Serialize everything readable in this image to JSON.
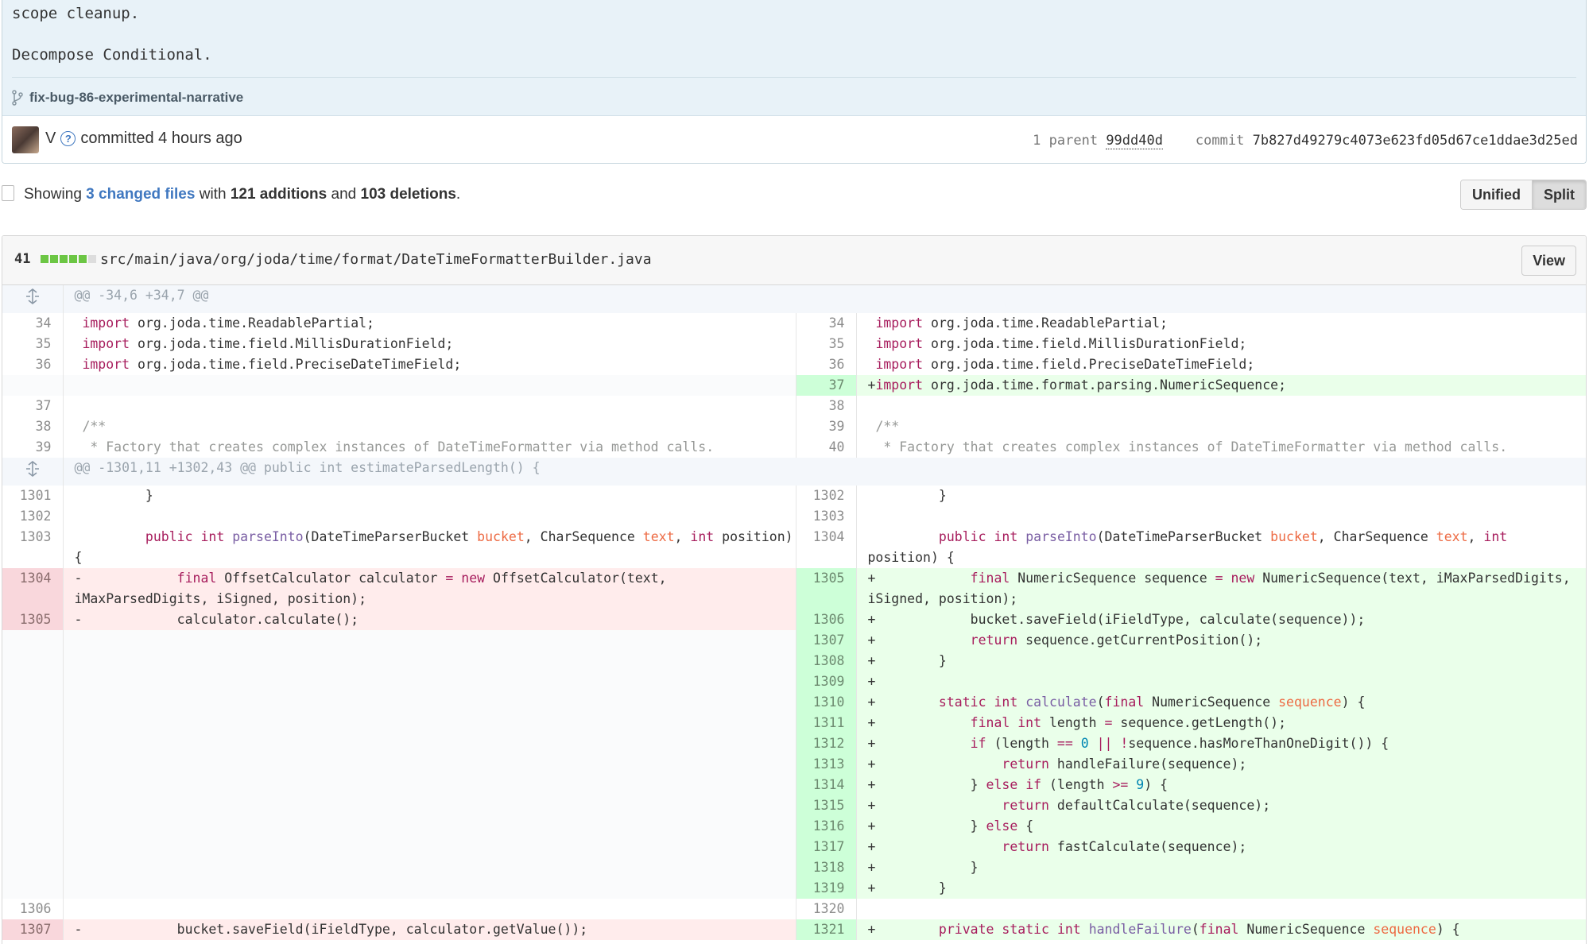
{
  "commit": {
    "message_lines": [
      "scope cleanup.",
      "Decompose Conditional."
    ],
    "branch": "fix-bug-86-experimental-narrative",
    "author": "V",
    "committed_text": "committed 4 hours ago",
    "parent_label": "1 parent",
    "parent_sha": "99dd40d",
    "commit_label": "commit",
    "commit_sha": "7b827d49279c4073e623fd05d67ce1ddae3d25ed"
  },
  "toc": {
    "showing": "Showing",
    "changed_files": "3 changed files",
    "with": "with",
    "additions": "121 additions",
    "and": "and",
    "deletions": "103 deletions",
    "period": ".",
    "unified_label": "Unified",
    "split_label": "Split"
  },
  "file": {
    "changes": "41",
    "diffstat": [
      "add",
      "add",
      "add",
      "add",
      "add",
      "neutral"
    ],
    "path": "src/main/java/org/joda/time/format/DateTimeFormatterBuilder.java",
    "view_label": "View"
  },
  "diff_rows": [
    {
      "type": "hunk",
      "text": "@@ -34,6 +34,7 @@"
    },
    {
      "type": "ctx",
      "ln": "34",
      "rn": "34",
      "code": " import org.joda.time.ReadablePartial;"
    },
    {
      "type": "ctx",
      "ln": "35",
      "rn": "35",
      "code": " import org.joda.time.field.MillisDurationField;"
    },
    {
      "type": "ctx",
      "ln": "36",
      "rn": "36",
      "code": " import org.joda.time.field.PreciseDateTimeField;"
    },
    {
      "type": "addonly",
      "rn": "37",
      "right": "+import org.joda.time.format.parsing.NumericSequence;"
    },
    {
      "type": "ctx",
      "ln": "37",
      "rn": "38",
      "code": ""
    },
    {
      "type": "ctx",
      "ln": "38",
      "rn": "39",
      "code": " /**"
    },
    {
      "type": "ctx",
      "ln": "39",
      "rn": "40",
      "code": "  * Factory that creates complex instances of DateTimeFormatter via method calls."
    },
    {
      "type": "hunk",
      "text": "@@ -1301,11 +1302,43 @@ public int estimateParsedLength() {"
    },
    {
      "type": "ctx",
      "ln": "1301",
      "rn": "1302",
      "code": "         }"
    },
    {
      "type": "ctx",
      "ln": "1302",
      "rn": "1303",
      "code": ""
    },
    {
      "type": "ctx",
      "ln": "1303",
      "rn": "1304",
      "code": "         public int parseInto(DateTimeParserBucket bucket, CharSequence text, int position) {"
    },
    {
      "type": "change",
      "ln": "1304",
      "rn": "1305",
      "left": "-            final OffsetCalculator calculator = new OffsetCalculator(text, iMaxParsedDigits, iSigned, position);",
      "right": "+            final NumericSequence sequence = new NumericSequence(text, iMaxParsedDigits, iSigned, position);"
    },
    {
      "type": "change",
      "ln": "1305",
      "rn": "1306",
      "left": "-            calculator.calculate();",
      "right": "+            bucket.saveField(iFieldType, calculate(sequence));"
    },
    {
      "type": "addonly",
      "rn": "1307",
      "right": "+            return sequence.getCurrentPosition();"
    },
    {
      "type": "addonly",
      "rn": "1308",
      "right": "+        }"
    },
    {
      "type": "addonly",
      "rn": "1309",
      "right": "+"
    },
    {
      "type": "addonly",
      "rn": "1310",
      "right": "+        static int calculate(final NumericSequence sequence) {"
    },
    {
      "type": "addonly",
      "rn": "1311",
      "right": "+            final int length = sequence.getLength();"
    },
    {
      "type": "addonly",
      "rn": "1312",
      "right": "+            if (length == 0 || !sequence.hasMoreThanOneDigit()) {"
    },
    {
      "type": "addonly",
      "rn": "1313",
      "right": "+                return handleFailure(sequence);"
    },
    {
      "type": "addonly",
      "rn": "1314",
      "right": "+            } else if (length >= 9) {"
    },
    {
      "type": "addonly",
      "rn": "1315",
      "right": "+                return defaultCalculate(sequence);"
    },
    {
      "type": "addonly",
      "rn": "1316",
      "right": "+            } else {"
    },
    {
      "type": "addonly",
      "rn": "1317",
      "right": "+                return fastCalculate(sequence);"
    },
    {
      "type": "addonly",
      "rn": "1318",
      "right": "+            }"
    },
    {
      "type": "addonly",
      "rn": "1319",
      "right": "+        }"
    },
    {
      "type": "ctx",
      "ln": "1306",
      "rn": "1320",
      "code": ""
    },
    {
      "type": "change",
      "ln": "1307",
      "rn": "1321",
      "left": "-            bucket.saveField(iFieldType, calculator.getValue());",
      "right": "+        private static int handleFailure(final NumericSequence sequence) {"
    }
  ]
}
